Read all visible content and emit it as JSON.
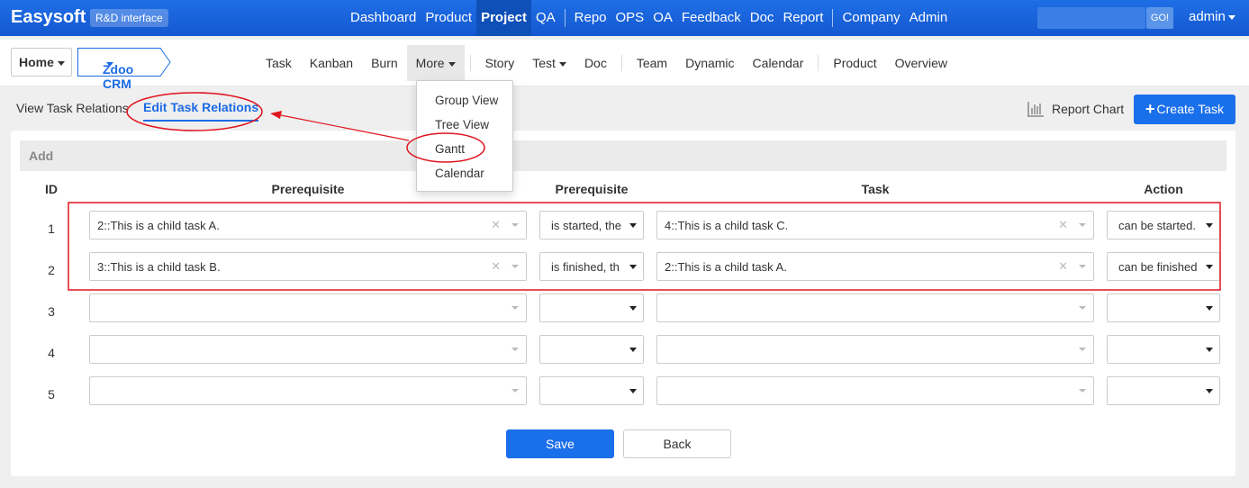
{
  "topbar": {
    "brand": "Easysoft",
    "badge": "R&D interface",
    "nav": [
      "Dashboard",
      "Product",
      "Project",
      "QA",
      "Repo",
      "OPS",
      "OA",
      "Feedback",
      "Doc",
      "Report",
      "Company",
      "Admin"
    ],
    "active": "Project",
    "search_button": "GO!",
    "user": "admin",
    "bg_color": "#1a65dc"
  },
  "breadcrumb": {
    "home": "Home",
    "project": "Zdoo CRM"
  },
  "subnav": [
    "Task",
    "Kanban",
    "Burn",
    "More",
    "Story",
    "Test",
    "Doc",
    "Team",
    "Dynamic",
    "Calendar",
    "Product",
    "Overview"
  ],
  "more_menu": [
    "Group View",
    "Tree View",
    "Gantt",
    "Calendar"
  ],
  "page": {
    "view_tab": "View Task Relations",
    "edit_tab": "Edit Task Relations",
    "report_chart": "Report Chart",
    "create_task": "Create Task"
  },
  "panel": {
    "title": "Add",
    "headers": {
      "id": "ID",
      "prerequisite": "Prerequisite",
      "condition": "Prerequisite",
      "task": "Task",
      "action": "Action"
    },
    "rows": [
      {
        "id": "1",
        "pre": "2::This is a child task A.",
        "cond": "is started, the",
        "task": "4::This is a child task C.",
        "action": "can be started."
      },
      {
        "id": "2",
        "pre": "3::This is a child task B.",
        "cond": "is finished, th",
        "task": "2::This is a child task A.",
        "action": "can be finished"
      },
      {
        "id": "3",
        "pre": "",
        "cond": "",
        "task": "",
        "action": ""
      },
      {
        "id": "4",
        "pre": "",
        "cond": "",
        "task": "",
        "action": ""
      },
      {
        "id": "5",
        "pre": "",
        "cond": "",
        "task": "",
        "action": ""
      }
    ],
    "save": "Save",
    "back": "Back"
  },
  "colors": {
    "accent": "#1a6fea",
    "annotation": "#e0141e"
  }
}
